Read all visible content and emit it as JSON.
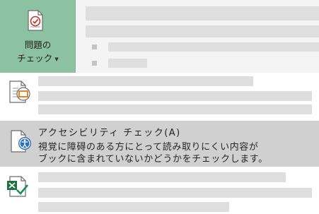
{
  "check_button": {
    "label_line1": "問題の",
    "label_line2": "チェック",
    "icon": "document-checklist-icon",
    "color": "#8cc2a1"
  },
  "menu": {
    "items": [
      {
        "icon": "inspect-document-icon"
      },
      {
        "icon": "accessibility-checker-icon",
        "title": "アクセシビリティ チェック(A)",
        "description_line1": "視覚に障碍のある方にとって読み取りにくい内容が",
        "description_line2": "ブックに含まれていないかどうかをチェックします。"
      },
      {
        "icon": "compatibility-checker-icon"
      }
    ],
    "highlight_color": "#d0d0d0"
  }
}
